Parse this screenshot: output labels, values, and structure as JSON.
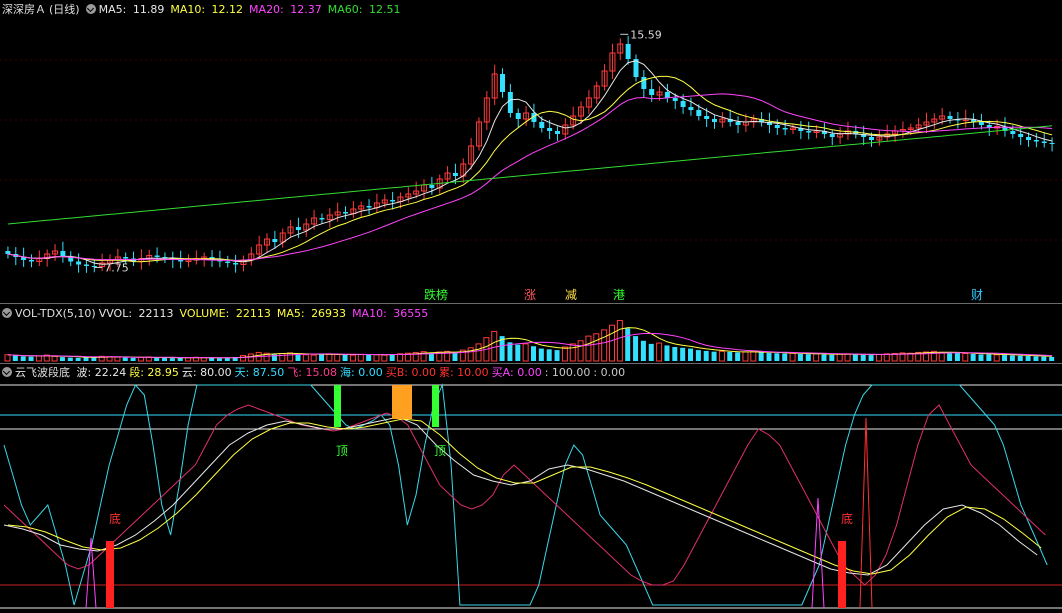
{
  "colors": {
    "up": "#ff3c3c",
    "down": "#33e0ff",
    "ma5": "#e8e8e8",
    "ma10": "#ffff44",
    "ma20": "#ff44ff",
    "ma60": "#33dd33",
    "red": "#ff2020",
    "green": "#33ff33",
    "orange": "#ffa020",
    "cyan_line": "#3ad8e8",
    "bg": "#000000"
  },
  "main": {
    "stock_name": "深深房Ａ",
    "period": "(日线)",
    "ma5_label": "MA5:",
    "ma5_value": "11.89",
    "ma10_label": "MA10:",
    "ma10_value": "12.12",
    "ma20_label": "MA20:",
    "ma20_value": "12.37",
    "ma60_label": "MA60:",
    "ma60_value": "12.51",
    "high_label": "15.59",
    "low_label": "7.75",
    "events": [
      {
        "text": "跌榜",
        "color": "#33ff33"
      },
      {
        "text": "涨",
        "color": "#ff5a5a"
      },
      {
        "text": "减",
        "color": "#ffe040"
      },
      {
        "text": "港",
        "color": "#33ff33"
      },
      {
        "text": "财",
        "color": "#33ccff"
      }
    ]
  },
  "volume": {
    "title": "VOL-TDX(5,10)",
    "vvol_label": "VVOL:",
    "vvol_value": "22113",
    "volume_label": "VOLUME:",
    "volume_value": "22113",
    "ma5_label": "MA5:",
    "ma5_value": "26933",
    "ma10_label": "MA10:",
    "ma10_value": "36555"
  },
  "indicator": {
    "title": "云飞波段底",
    "items": [
      {
        "label": "波:",
        "value": "22.24",
        "color": "#e8e8e8"
      },
      {
        "label": "段:",
        "value": "28.95",
        "color": "#ffff44"
      },
      {
        "label": "云:",
        "value": "80.00",
        "color": "#e8e8e8"
      },
      {
        "label": "天:",
        "value": "87.50",
        "color": "#33ddff"
      },
      {
        "label": "飞:",
        "value": "15.08",
        "color": "#ff3c8c"
      },
      {
        "label": "海:",
        "value": "0.00",
        "color": "#33ddff"
      },
      {
        "label": "买B:",
        "value": "0.00",
        "color": "#ff3030"
      },
      {
        "label": "累:",
        "value": "10.00",
        "color": "#ff3030"
      },
      {
        "label": "买A:",
        "value": "0.00",
        "color": "#ff44ff"
      },
      {
        "label": ":",
        "value": "100.00",
        "color": "#c8c8c8"
      },
      {
        "label": ":",
        "value": "0.00",
        "color": "#c8c8c8"
      }
    ],
    "signal_top": "顶",
    "signal_bottom": "底"
  },
  "chart_data": [
    {
      "type": "candlestick",
      "title": "深深房Ａ (日线)",
      "ylim": [
        7.0,
        16.0
      ],
      "series": [
        {
          "name": "MA5",
          "last": 11.89
        },
        {
          "name": "MA10",
          "last": 12.12
        },
        {
          "name": "MA20",
          "last": 12.37
        },
        {
          "name": "MA60",
          "last": 12.51
        }
      ],
      "max_price": 15.59,
      "min_price": 7.75,
      "close": [
        8.2,
        8.1,
        8.0,
        7.95,
        8.05,
        8.2,
        8.3,
        8.1,
        7.95,
        7.85,
        7.8,
        7.78,
        7.9,
        8.0,
        8.1,
        8.05,
        7.95,
        8.05,
        8.15,
        8.1,
        8.05,
        8.0,
        7.95,
        8.0,
        8.05,
        8.1,
        8.0,
        7.95,
        7.9,
        7.85,
        8.0,
        8.2,
        8.5,
        8.7,
        8.6,
        8.9,
        9.1,
        9.0,
        9.2,
        9.4,
        9.35,
        9.5,
        9.6,
        9.55,
        9.7,
        9.8,
        9.75,
        9.9,
        10.0,
        9.95,
        10.1,
        10.2,
        10.3,
        10.5,
        10.4,
        10.7,
        10.9,
        10.8,
        11.2,
        11.8,
        12.6,
        13.4,
        14.2,
        13.6,
        12.9,
        12.7,
        12.9,
        12.6,
        12.4,
        12.3,
        12.2,
        12.5,
        12.8,
        13.1,
        13.4,
        13.8,
        14.3,
        14.9,
        15.2,
        14.7,
        14.1,
        13.7,
        13.5,
        13.6,
        13.4,
        13.3,
        13.1,
        13.0,
        12.8,
        12.7,
        12.6,
        12.7,
        12.6,
        12.5,
        12.6,
        12.7,
        12.6,
        12.5,
        12.4,
        12.35,
        12.4,
        12.3,
        12.25,
        12.3,
        12.2,
        12.1,
        12.2,
        12.3,
        12.2,
        12.1,
        12.0,
        12.1,
        12.2,
        12.3,
        12.35,
        12.4,
        12.5,
        12.6,
        12.7,
        12.8,
        12.7,
        12.65,
        12.7,
        12.6,
        12.5,
        12.4,
        12.45,
        12.3,
        12.2,
        12.1,
        12.0,
        11.95,
        11.9,
        11.89
      ]
    },
    {
      "type": "bar",
      "title": "VOL-TDX(5,10)",
      "series": [
        {
          "name": "VOLUME",
          "last": 22113
        },
        {
          "name": "MA5",
          "last": 26933
        },
        {
          "name": "MA10",
          "last": 36555
        }
      ],
      "values": [
        40,
        35,
        30,
        28,
        32,
        38,
        30,
        25,
        22,
        20,
        24,
        26,
        30,
        28,
        25,
        22,
        20,
        24,
        26,
        22,
        20,
        18,
        20,
        22,
        24,
        22,
        20,
        18,
        22,
        26,
        35,
        45,
        55,
        50,
        42,
        48,
        52,
        45,
        40,
        38,
        42,
        46,
        44,
        40,
        38,
        42,
        45,
        40,
        38,
        42,
        46,
        50,
        55,
        60,
        52,
        58,
        62,
        55,
        70,
        85,
        110,
        150,
        190,
        160,
        120,
        105,
        110,
        95,
        80,
        75,
        70,
        90,
        110,
        130,
        160,
        175,
        200,
        230,
        260,
        210,
        160,
        130,
        110,
        115,
        100,
        90,
        85,
        80,
        70,
        65,
        60,
        62,
        58,
        55,
        58,
        60,
        55,
        52,
        50,
        48,
        50,
        46,
        44,
        46,
        42,
        40,
        44,
        46,
        42,
        40,
        38,
        42,
        46,
        48,
        52,
        50,
        55,
        58,
        62,
        55,
        50,
        52,
        48,
        45,
        42,
        44,
        40,
        38,
        36,
        34,
        32,
        30,
        28,
        26
      ]
    },
    {
      "type": "line",
      "title": "云飞波段底",
      "ylim": [
        0,
        100
      ],
      "series": [
        {
          "name": "波",
          "last": 22.24
        },
        {
          "name": "段",
          "last": 28.95
        },
        {
          "name": "云",
          "last": 80.0
        },
        {
          "name": "天",
          "last": 87.5
        },
        {
          "name": "飞",
          "last": 15.08
        },
        {
          "name": "海",
          "last": 0.0
        },
        {
          "name": "买B",
          "last": 0.0
        },
        {
          "name": "累",
          "last": 10.0
        },
        {
          "name": "买A",
          "last": 0.0
        }
      ],
      "reference_lines": [
        100,
        80,
        0
      ]
    }
  ]
}
